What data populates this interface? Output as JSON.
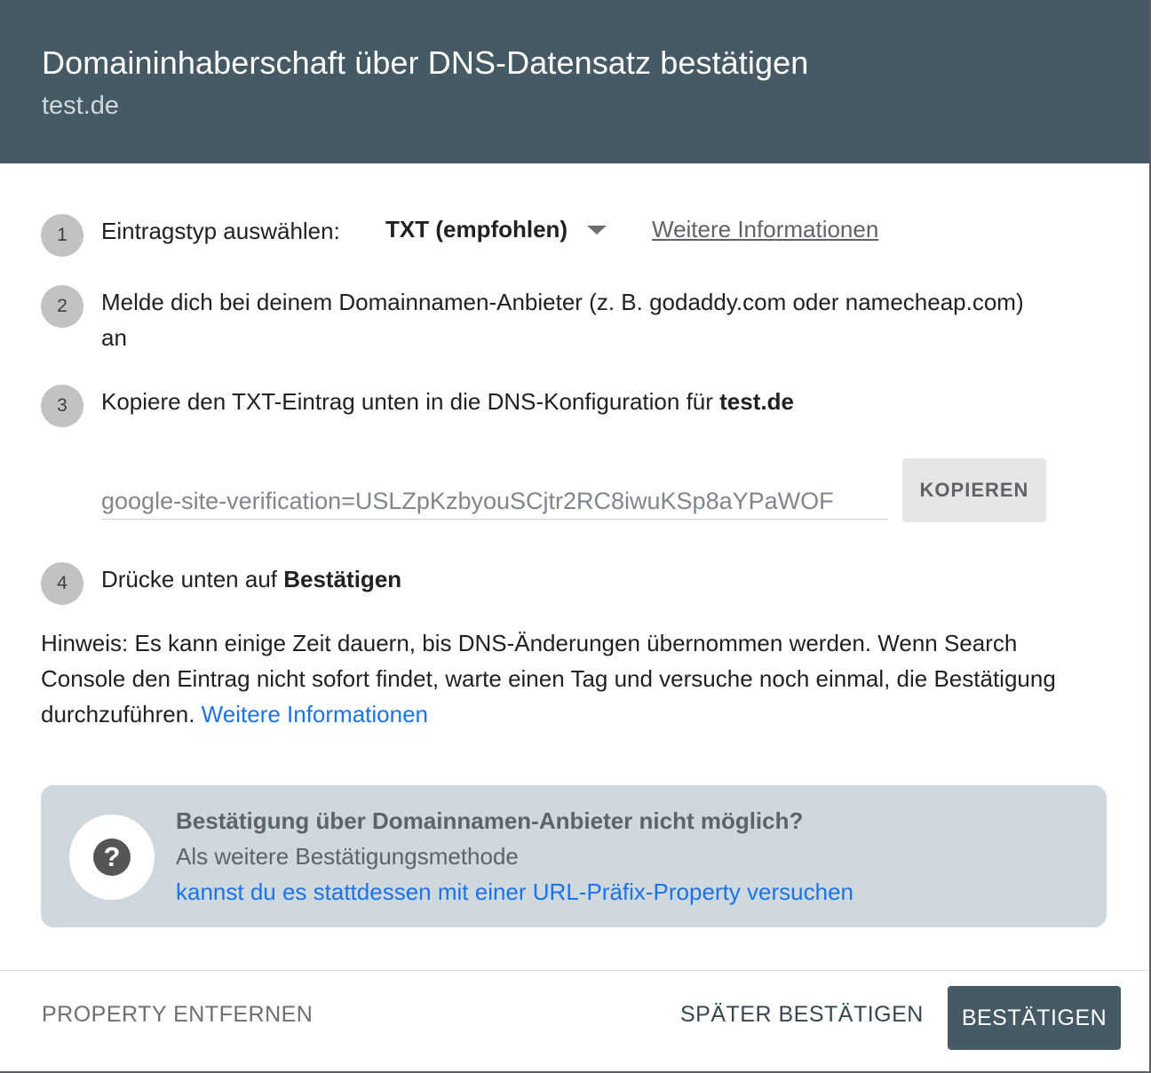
{
  "header": {
    "title": "Domaininhaberschaft über DNS-Datensatz bestätigen",
    "subtitle": "test.de"
  },
  "steps": [
    {
      "number": "1",
      "label": "Eintragstyp auswählen:",
      "select_value": "TXT (empfohlen)",
      "link": "Weitere Informationen"
    },
    {
      "number": "2",
      "line1": "Melde dich bei deinem Domainnamen-Anbieter (z. B. godaddy.com oder namecheap.com)",
      "line2": "an"
    },
    {
      "number": "3",
      "text": "Kopiere den TXT-Eintrag unten in die DNS-Konfiguration für ",
      "bold": "test.de"
    },
    {
      "number": "4",
      "text": "Drücke unten auf ",
      "bold": "Bestätigen"
    }
  ],
  "txt_record": {
    "value": "google-site-verification=USLZpKzbyouSCjtr2RC8iwuKSp8aYPaWOF",
    "copy_label": "KOPIEREN"
  },
  "note": {
    "text": "Hinweis: Es kann einige Zeit dauern, bis DNS-Änderungen übernommen werden. Wenn Search Console den Eintrag nicht sofort findet, warte einen Tag und versuche noch einmal, die Bestätigung durchzuführen. ",
    "link": "Weitere Informationen"
  },
  "alternative": {
    "icon": "help-icon",
    "title": "Bestätigung über Domainnamen-Anbieter nicht möglich?",
    "text": "Als weitere Bestätigungsmethode",
    "link": "kannst du es stattdessen mit einer URL-Präfix-Property versuchen"
  },
  "footer": {
    "remove_label": "PROPERTY ENTFERNEN",
    "later_label": "SPÄTER BESTÄTIGEN",
    "confirm_label": "BESTÄTIGEN"
  },
  "colors": {
    "header_bg": "#455a64",
    "info_box_bg": "#cfd8dc",
    "link_blue": "#1a73e8",
    "primary_button": "#455a64"
  }
}
